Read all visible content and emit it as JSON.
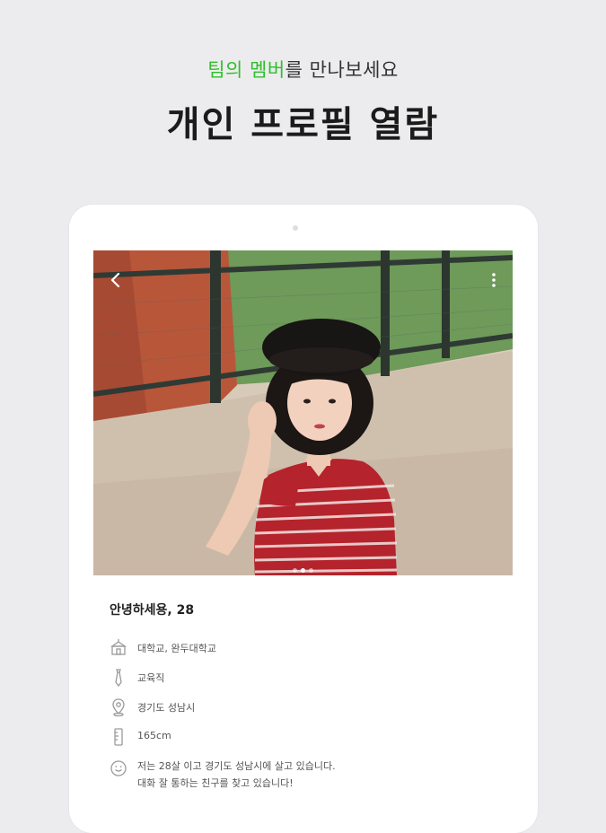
{
  "header": {
    "subtitle_accent": "팀의 멤버",
    "subtitle_rest": "를 만나보세요",
    "title": "개인 프로필 열람"
  },
  "profile": {
    "name_age": "안녕하세용, 28",
    "school": "대학교, 완두대학교",
    "job": "교육직",
    "location": "경기도 성남시",
    "height": "165cm",
    "bio_line1": "저는 28살 이고 경기도 성남시에 살고 있습니다.",
    "bio_line2": "대화 잘 통하는 친구를 찾고 있습니다!"
  },
  "photo": {
    "page_count": 3,
    "current_page": 2
  },
  "icons": {
    "back": "chevron-left-icon",
    "more": "more-vertical-icon",
    "school": "school-building-icon",
    "job": "tie-icon",
    "location": "location-pin-icon",
    "height": "height-ruler-icon",
    "bio": "smile-chat-icon"
  },
  "colors": {
    "accent": "#2fbf2b",
    "background": "#ececee"
  }
}
